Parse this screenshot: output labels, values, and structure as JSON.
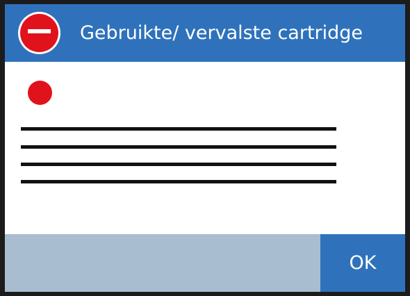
{
  "dialog": {
    "title": "Gebruikte/ vervalste cartridge",
    "header_icon": "stop-icon",
    "status_icon": "red-dot-icon",
    "message_lines": 4,
    "colors": {
      "header": "#2f72bb",
      "footer": "#a9bdd0",
      "alert_red": "#e0131d"
    }
  },
  "footer": {
    "ok_label": "OK"
  }
}
